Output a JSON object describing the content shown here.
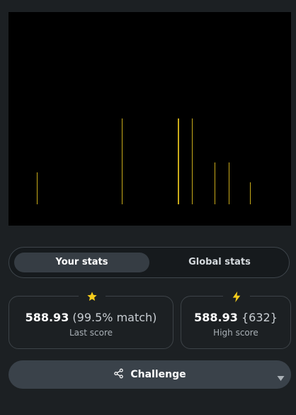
{
  "visualizer": {
    "bars": [
      {
        "pos": 0.1,
        "level": 0.25
      },
      {
        "pos": 0.4,
        "level": 0.67
      },
      {
        "pos": 0.6,
        "level": 0.67,
        "bold": true
      },
      {
        "pos": 0.65,
        "level": 0.67
      },
      {
        "pos": 0.73,
        "level": 0.33
      },
      {
        "pos": 0.78,
        "level": 0.33
      },
      {
        "pos": 0.855,
        "level": 0.17
      }
    ],
    "bar_color": "#c9ab1a"
  },
  "stats_toggle": {
    "your_stats": "Your stats",
    "global_stats": "Global stats",
    "active": "your_stats"
  },
  "last_score": {
    "score": "588.93",
    "match": "(99.5% match)",
    "label": "Last score",
    "icon": "star-icon",
    "icon_color": "#f5cc1c"
  },
  "high_score": {
    "score": "588.93",
    "value": "{632}",
    "label": "High score",
    "icon": "lightning-icon",
    "icon_color": "#f5cc1c"
  },
  "challenge_button": {
    "label": "Challenge",
    "icon": "share-icon",
    "dropdown_icon": "caret-down-icon"
  }
}
